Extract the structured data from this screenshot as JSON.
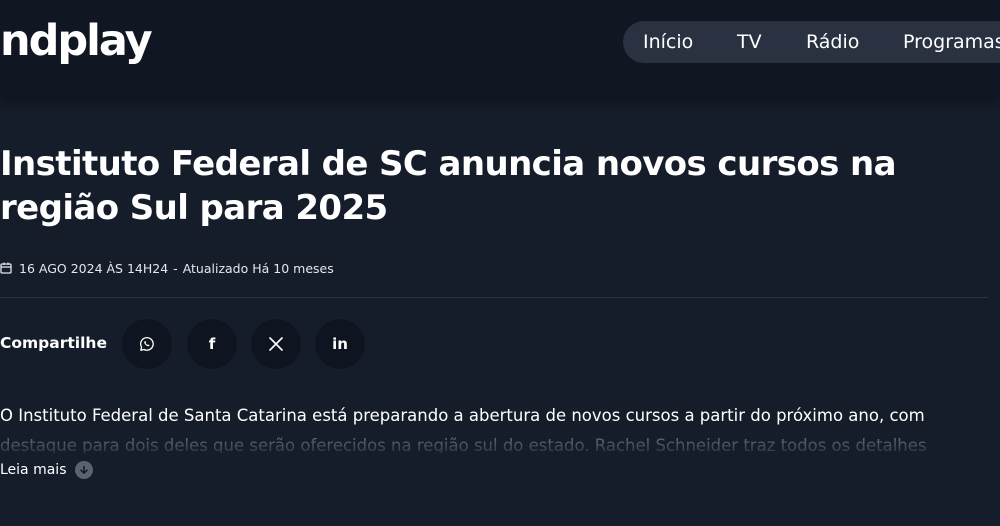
{
  "header": {
    "logo": "ndplay",
    "nav": {
      "items": [
        {
          "label": "Início"
        },
        {
          "label": "TV"
        },
        {
          "label": "Rádio"
        },
        {
          "label": "Programas"
        }
      ]
    }
  },
  "article": {
    "title": "Instituto Federal de SC anuncia novos cursos na região Sul para 2025",
    "meta": {
      "date": "16 AGO 2024 ÀS 14H24",
      "separator": "-",
      "updated": "Atualizado Há 10 meses",
      "icon": "calendar-icon"
    },
    "share": {
      "label": "Compartilhe",
      "buttons": [
        {
          "icon": "whatsapp-icon"
        },
        {
          "icon": "facebook-icon",
          "glyph": "f"
        },
        {
          "icon": "x-icon",
          "glyph": "𝕏"
        },
        {
          "icon": "linkedin-icon",
          "glyph": "in"
        }
      ]
    },
    "lead": {
      "line1": "O Instituto Federal de Santa Catarina está preparando a abertura de novos cursos a partir do próximo ano, com",
      "line2": "destaque para dois deles que serão oferecidos na região sul do estado. Rachel Schneider traz todos os detalhes"
    },
    "read_more": {
      "label": "Leia mais",
      "icon": "chevron-down-icon"
    }
  },
  "colors": {
    "background": "#151d2b",
    "header_background": "#101622",
    "nav_pill": "#2a3140",
    "share_button": "#0f1520"
  }
}
